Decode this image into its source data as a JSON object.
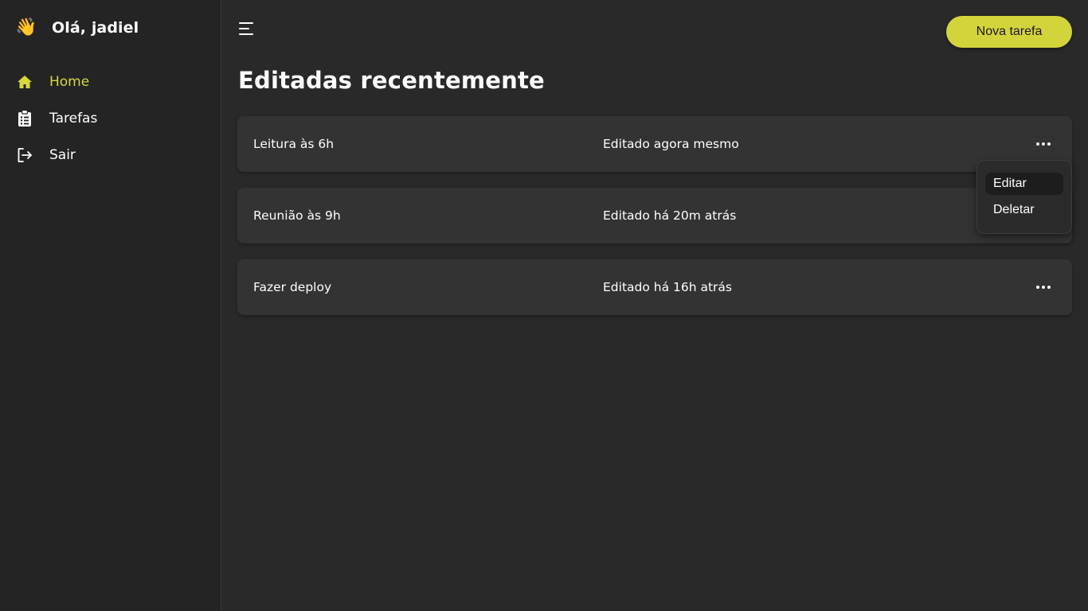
{
  "sidebar": {
    "greeting_icon": "waving-hand-icon",
    "greeting_emoji": "👋",
    "greeting": "Olá, jadiel",
    "items": [
      {
        "label": "Home",
        "icon": "home-icon",
        "active": true
      },
      {
        "label": "Tarefas",
        "icon": "clipboard-list-icon",
        "active": false
      },
      {
        "label": "Sair",
        "icon": "sign-out-icon",
        "active": false
      }
    ]
  },
  "header": {
    "menu_icon": "menu-icon",
    "new_task_label": "Nova tarefa"
  },
  "main": {
    "title": "Editadas recentemente",
    "tasks": [
      {
        "name": "Leitura às 6h",
        "edited": "Editado agora mesmo"
      },
      {
        "name": "Reunião às 9h",
        "edited": "Editado há 20m atrás"
      },
      {
        "name": "Fazer deploy",
        "edited": "Editado há 16h atrás"
      }
    ],
    "dropdown": {
      "items": [
        {
          "label": "Editar",
          "highlighted": true
        },
        {
          "label": "Deletar",
          "highlighted": false
        }
      ]
    }
  },
  "colors": {
    "accent": "#d3d43b",
    "background": "#292929",
    "sidebar": "#242424",
    "card": "#333333"
  }
}
